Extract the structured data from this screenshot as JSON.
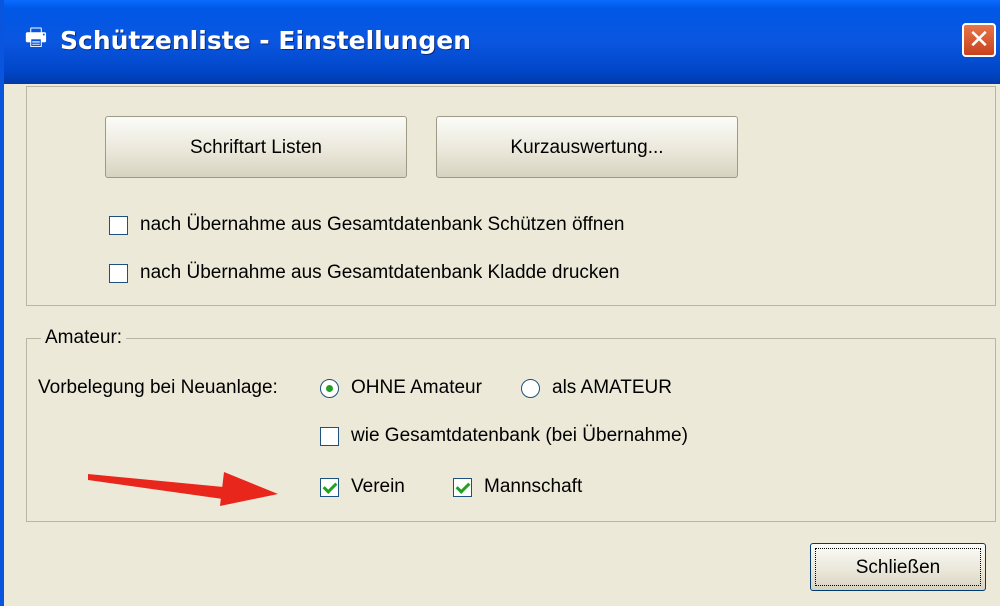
{
  "window": {
    "title": "Schützenliste - Einstellungen",
    "title_icon": "printer-icon",
    "close_label": "✕"
  },
  "group_general": {
    "fonts_button": "Schriftart Listen",
    "short_eval_button": "Kurzauswertung...",
    "options": [
      {
        "label": "nach Übernahme aus Gesamtdatenbank Schützen öffnen",
        "checked": false
      },
      {
        "label": "nach Übernahme aus Gesamtdatenbank Kladde drucken",
        "checked": false
      }
    ]
  },
  "group_amateur": {
    "legend": "Amateur:",
    "default_label": "Vorbelegung bei Neuanlage:",
    "radio_without": "OHNE Amateur",
    "radio_with": "als AMATEUR",
    "like_db_label": "wie Gesamtdatenbank (bei Übernahme)",
    "club_label": "Verein",
    "team_label": "Mannschaft"
  },
  "footer": {
    "close_button": "Schließen"
  },
  "colors": {
    "titlebar": "#0a56e0",
    "face": "#ece9d8",
    "arrow": "#e8261c"
  }
}
